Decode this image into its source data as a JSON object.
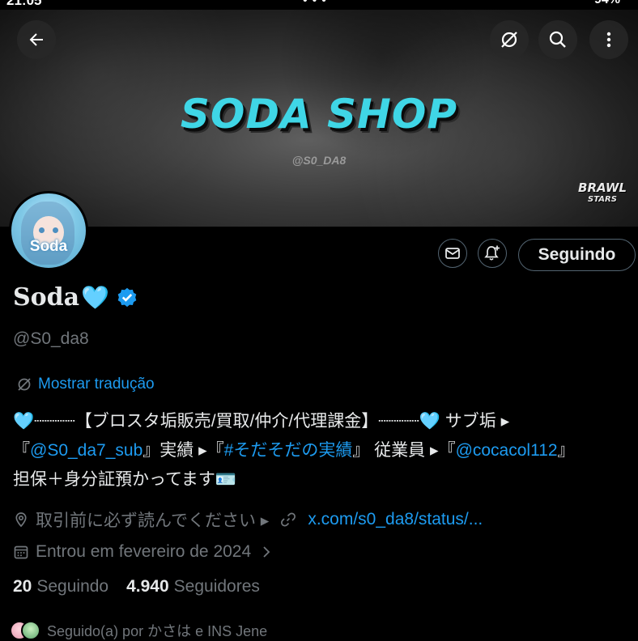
{
  "status_bar": {
    "time": "21:05",
    "battery": "94%"
  },
  "banner": {
    "title": "SODA SHOP",
    "subtitle": "@S0_DA8",
    "logo_line1": "BRAWL",
    "logo_line2": "STARS"
  },
  "header": {
    "back_icon": "arrow-left-icon",
    "grok_icon": "grok-icon",
    "search_icon": "search-icon",
    "more_icon": "more-vertical-icon"
  },
  "avatar": {
    "label": "Soda"
  },
  "actions": {
    "follow_label": "Seguindo",
    "message_icon": "mail-icon",
    "notify_icon": "bell-plus-icon"
  },
  "profile": {
    "name": "Soda",
    "name_emoji": "🩵",
    "handle": "@S0_da8",
    "verified": true,
    "translate_label": "Mostrar tradução"
  },
  "bio": {
    "line1_a": "🩵┈┈┈┈【ブロスタ垢販売/買取/仲介/代理課金】┈┈┈┈🩵 サブ垢 ▸",
    "line2_a": "『",
    "link1": "@S0_da7_sub",
    "line2_b": "』実績 ▸『",
    "link2": "#そだそだの実績",
    "line2_c": "』 従業員 ▸『",
    "link3": "@cocacol112",
    "line2_d": "』",
    "line3": "担保＋身分証預かってます🪪"
  },
  "meta": {
    "location": "取引前に必ず読んでください ▸",
    "website": "x.com/s0_da8/status/...",
    "joined": "Entrou em fevereiro de 2024"
  },
  "stats": {
    "following_count": "20",
    "following_label": "Seguindo",
    "followers_count": "4.940",
    "followers_label": "Seguidores"
  },
  "followed_by": "Seguido(a) por かさは e INS Jene",
  "colors": {
    "accent": "#1d9bf0",
    "muted": "#71767b",
    "heart": "#5cc8ef",
    "brand_cyan": "#3fd6e6"
  }
}
